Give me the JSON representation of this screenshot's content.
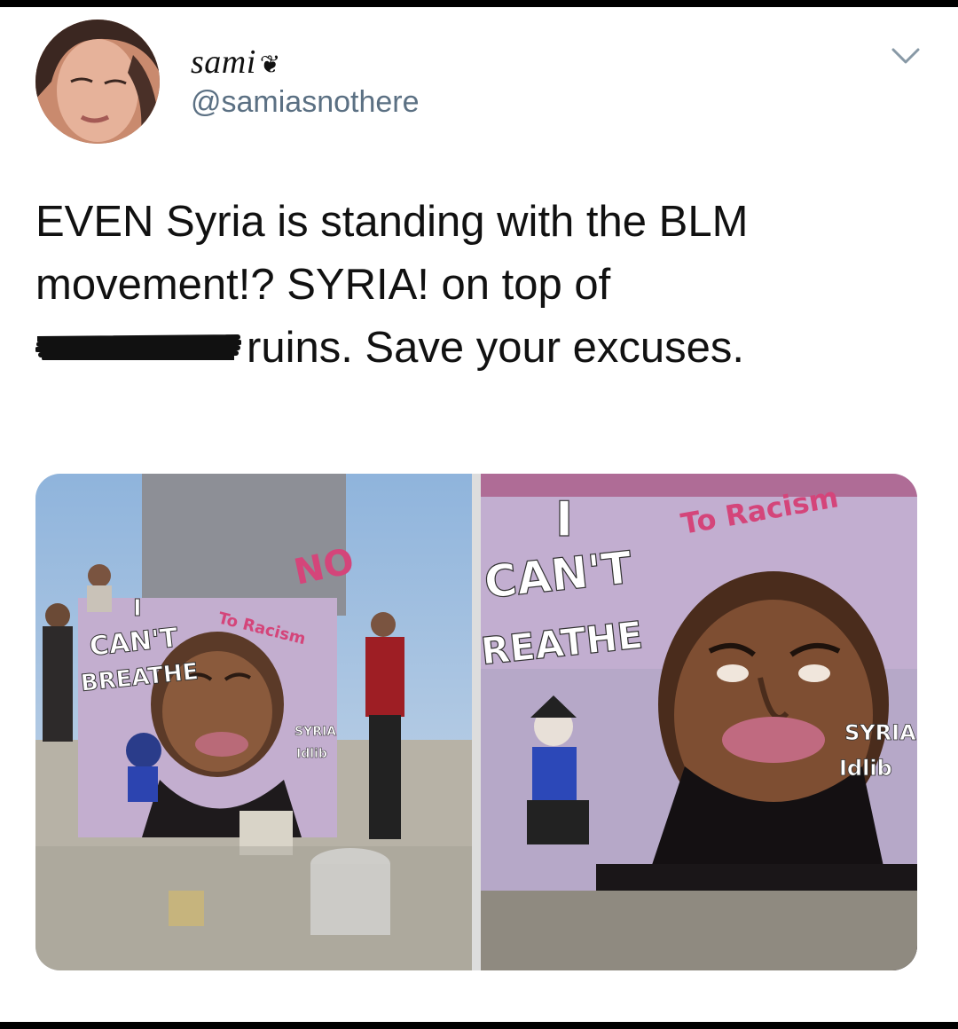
{
  "author": {
    "display_name": "sami",
    "name_emoji": "❦",
    "handle": "@samiasnothere"
  },
  "tweet": {
    "line1": "EVEN Syria is standing with the BLM",
    "line2": "movement!? SYRIA! on top of",
    "line3_after_redaction": "ruins. Save your excuses."
  },
  "media": {
    "photo_left": {
      "mural_no": "NO",
      "mural_to_racism": "To Racism",
      "mural_i": "I",
      "mural_cant": "CAN'T",
      "mural_breathe": "BREATHE",
      "mural_syria": "SYRIA",
      "mural_idlib": "Idlib"
    },
    "photo_right": {
      "mural_i": "I",
      "mural_cant": "CAN'T",
      "mural_breathe": "REATHE",
      "mural_to_racism": "To Racism",
      "mural_syria": "SYRIA",
      "mural_idlib": "Idlib"
    }
  },
  "colors": {
    "text": "#111111",
    "handle": "#5b7083",
    "chevron": "#8899a6"
  }
}
